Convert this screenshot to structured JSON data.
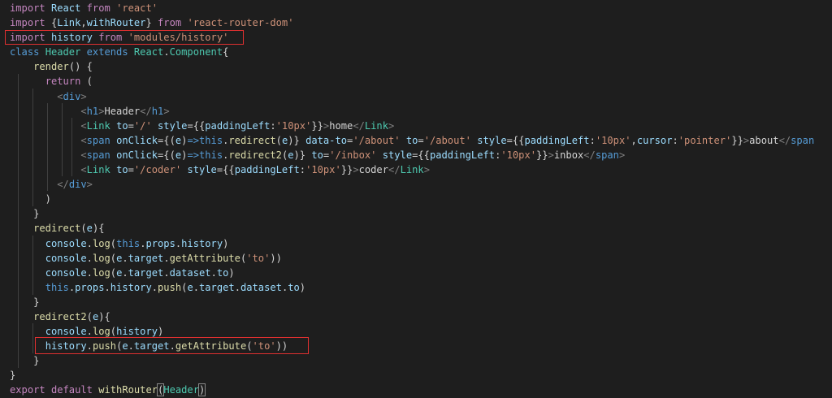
{
  "editor": {
    "theme_colors": {
      "background": "#1e1e1e",
      "keyword": "#569cd6",
      "control": "#c586c0",
      "string": "#ce9178",
      "function": "#dcdcaa",
      "type": "#4ec9b0",
      "variable": "#9cdcfe",
      "tag": "#569cd6",
      "tag_bracket": "#808080",
      "text": "#d4d4d4",
      "highlight_box": "#e03030"
    },
    "lines": [
      [
        [
          "kw-ctrl",
          "import"
        ],
        [
          "t",
          " "
        ],
        [
          "var",
          "React"
        ],
        [
          "t",
          " "
        ],
        [
          "kw-ctrl",
          "from"
        ],
        [
          "t",
          " "
        ],
        [
          "str",
          "'react'"
        ]
      ],
      [
        [
          "kw-ctrl",
          "import"
        ],
        [
          "t",
          " {"
        ],
        [
          "var",
          "Link"
        ],
        [
          "t",
          ","
        ],
        [
          "var",
          "withRouter"
        ],
        [
          "t",
          "} "
        ],
        [
          "kw-ctrl",
          "from"
        ],
        [
          "t",
          " "
        ],
        [
          "str",
          "'react-router-dom'"
        ]
      ],
      [
        [
          "kw-ctrl",
          "import"
        ],
        [
          "t",
          " "
        ],
        [
          "var",
          "history"
        ],
        [
          "t",
          " "
        ],
        [
          "kw-ctrl",
          "from"
        ],
        [
          "t",
          " "
        ],
        [
          "str",
          "'modules/history'"
        ]
      ],
      [
        [
          "kw",
          "class"
        ],
        [
          "t",
          " "
        ],
        [
          "type",
          "Header"
        ],
        [
          "t",
          " "
        ],
        [
          "kw",
          "extends"
        ],
        [
          "t",
          " "
        ],
        [
          "type",
          "React"
        ],
        [
          "t",
          "."
        ],
        [
          "type",
          "Component"
        ],
        [
          "t",
          "{"
        ]
      ],
      [
        [
          "t",
          "    "
        ],
        [
          "fn",
          "render"
        ],
        [
          "t",
          "() {"
        ]
      ],
      [
        [
          "t",
          "      "
        ],
        [
          "kw-ctrl",
          "return"
        ],
        [
          "t",
          " ("
        ]
      ],
      [
        [
          "t",
          "        "
        ],
        [
          "tb",
          "<"
        ],
        [
          "tag",
          "div"
        ],
        [
          "tb",
          ">"
        ]
      ],
      [
        [
          "t",
          "            "
        ],
        [
          "tb",
          "<"
        ],
        [
          "tag",
          "h1"
        ],
        [
          "tb",
          ">"
        ],
        [
          "t",
          "Header"
        ],
        [
          "tb",
          "</"
        ],
        [
          "tag",
          "h1"
        ],
        [
          "tb",
          ">"
        ]
      ],
      [
        [
          "t",
          "            "
        ],
        [
          "tb",
          "<"
        ],
        [
          "type",
          "Link"
        ],
        [
          "t",
          " "
        ],
        [
          "var",
          "to"
        ],
        [
          "t",
          "="
        ],
        [
          "str",
          "'/'"
        ],
        [
          "t",
          " "
        ],
        [
          "var",
          "style"
        ],
        [
          "t",
          "={{"
        ],
        [
          "var",
          "paddingLeft"
        ],
        [
          "t",
          ":"
        ],
        [
          "str",
          "'10px'"
        ],
        [
          "t",
          "}}"
        ],
        [
          "tb",
          ">"
        ],
        [
          "t",
          "home"
        ],
        [
          "tb",
          "</"
        ],
        [
          "type",
          "Link"
        ],
        [
          "tb",
          ">"
        ]
      ],
      [
        [
          "t",
          "            "
        ],
        [
          "tb",
          "<"
        ],
        [
          "tag",
          "span"
        ],
        [
          "t",
          " "
        ],
        [
          "var",
          "onClick"
        ],
        [
          "t",
          "={("
        ],
        [
          "var",
          "e"
        ],
        [
          "t",
          ")"
        ],
        [
          "kw",
          "=>"
        ],
        [
          "kw",
          "this"
        ],
        [
          "t",
          "."
        ],
        [
          "fn",
          "redirect"
        ],
        [
          "t",
          "("
        ],
        [
          "var",
          "e"
        ],
        [
          "t",
          ")} "
        ],
        [
          "var",
          "data-to"
        ],
        [
          "t",
          "="
        ],
        [
          "str",
          "'/about'"
        ],
        [
          "t",
          " "
        ],
        [
          "var",
          "to"
        ],
        [
          "t",
          "="
        ],
        [
          "str",
          "'/about'"
        ],
        [
          "t",
          " "
        ],
        [
          "var",
          "style"
        ],
        [
          "t",
          "={{"
        ],
        [
          "var",
          "paddingLeft"
        ],
        [
          "t",
          ":"
        ],
        [
          "str",
          "'10px'"
        ],
        [
          "t",
          ","
        ],
        [
          "var",
          "cursor"
        ],
        [
          "t",
          ":"
        ],
        [
          "str",
          "'pointer'"
        ],
        [
          "t",
          "}}"
        ],
        [
          "tb",
          ">"
        ],
        [
          "t",
          "about"
        ],
        [
          "tb",
          "</"
        ],
        [
          "tag",
          "span"
        ]
      ],
      [
        [
          "t",
          "            "
        ],
        [
          "tb",
          "<"
        ],
        [
          "tag",
          "span"
        ],
        [
          "t",
          " "
        ],
        [
          "var",
          "onClick"
        ],
        [
          "t",
          "={("
        ],
        [
          "var",
          "e"
        ],
        [
          "t",
          ")"
        ],
        [
          "kw",
          "=>"
        ],
        [
          "kw",
          "this"
        ],
        [
          "t",
          "."
        ],
        [
          "fn",
          "redirect2"
        ],
        [
          "t",
          "("
        ],
        [
          "var",
          "e"
        ],
        [
          "t",
          ")} "
        ],
        [
          "var",
          "to"
        ],
        [
          "t",
          "="
        ],
        [
          "str",
          "'/inbox'"
        ],
        [
          "t",
          " "
        ],
        [
          "var",
          "style"
        ],
        [
          "t",
          "={{"
        ],
        [
          "var",
          "paddingLeft"
        ],
        [
          "t",
          ":"
        ],
        [
          "str",
          "'10px'"
        ],
        [
          "t",
          "}}"
        ],
        [
          "tb",
          ">"
        ],
        [
          "t",
          "inbox"
        ],
        [
          "tb",
          "</"
        ],
        [
          "tag",
          "span"
        ],
        [
          "tb",
          ">"
        ]
      ],
      [
        [
          "t",
          "            "
        ],
        [
          "tb",
          "<"
        ],
        [
          "type",
          "Link"
        ],
        [
          "t",
          " "
        ],
        [
          "var",
          "to"
        ],
        [
          "t",
          "="
        ],
        [
          "str",
          "'/coder'"
        ],
        [
          "t",
          " "
        ],
        [
          "var",
          "style"
        ],
        [
          "t",
          "={{"
        ],
        [
          "var",
          "paddingLeft"
        ],
        [
          "t",
          ":"
        ],
        [
          "str",
          "'10px'"
        ],
        [
          "t",
          "}}"
        ],
        [
          "tb",
          ">"
        ],
        [
          "t",
          "coder"
        ],
        [
          "tb",
          "</"
        ],
        [
          "type",
          "Link"
        ],
        [
          "tb",
          ">"
        ]
      ],
      [
        [
          "t",
          "        "
        ],
        [
          "tb",
          "</"
        ],
        [
          "tag",
          "div"
        ],
        [
          "tb",
          ">"
        ]
      ],
      [
        [
          "t",
          "      )"
        ]
      ],
      [
        [
          "t",
          "    }"
        ]
      ],
      [
        [
          "t",
          "    "
        ],
        [
          "fn",
          "redirect"
        ],
        [
          "t",
          "("
        ],
        [
          "var",
          "e"
        ],
        [
          "t",
          "){"
        ]
      ],
      [
        [
          "t",
          "      "
        ],
        [
          "var",
          "console"
        ],
        [
          "t",
          "."
        ],
        [
          "fn",
          "log"
        ],
        [
          "t",
          "("
        ],
        [
          "kw",
          "this"
        ],
        [
          "t",
          "."
        ],
        [
          "var",
          "props"
        ],
        [
          "t",
          "."
        ],
        [
          "var",
          "history"
        ],
        [
          "t",
          ")"
        ]
      ],
      [
        [
          "t",
          "      "
        ],
        [
          "var",
          "console"
        ],
        [
          "t",
          "."
        ],
        [
          "fn",
          "log"
        ],
        [
          "t",
          "("
        ],
        [
          "var",
          "e"
        ],
        [
          "t",
          "."
        ],
        [
          "var",
          "target"
        ],
        [
          "t",
          "."
        ],
        [
          "fn",
          "getAttribute"
        ],
        [
          "t",
          "("
        ],
        [
          "str",
          "'to'"
        ],
        [
          "t",
          "))"
        ]
      ],
      [
        [
          "t",
          "      "
        ],
        [
          "var",
          "console"
        ],
        [
          "t",
          "."
        ],
        [
          "fn",
          "log"
        ],
        [
          "t",
          "("
        ],
        [
          "var",
          "e"
        ],
        [
          "t",
          "."
        ],
        [
          "var",
          "target"
        ],
        [
          "t",
          "."
        ],
        [
          "var",
          "dataset"
        ],
        [
          "t",
          "."
        ],
        [
          "var",
          "to"
        ],
        [
          "t",
          ")"
        ]
      ],
      [
        [
          "t",
          "      "
        ],
        [
          "kw",
          "this"
        ],
        [
          "t",
          "."
        ],
        [
          "var",
          "props"
        ],
        [
          "t",
          "."
        ],
        [
          "var",
          "history"
        ],
        [
          "t",
          "."
        ],
        [
          "fn",
          "push"
        ],
        [
          "t",
          "("
        ],
        [
          "var",
          "e"
        ],
        [
          "t",
          "."
        ],
        [
          "var",
          "target"
        ],
        [
          "t",
          "."
        ],
        [
          "var",
          "dataset"
        ],
        [
          "t",
          "."
        ],
        [
          "var",
          "to"
        ],
        [
          "t",
          ")"
        ]
      ],
      [
        [
          "t",
          "    }"
        ]
      ],
      [
        [
          "t",
          "    "
        ],
        [
          "fn",
          "redirect2"
        ],
        [
          "t",
          "("
        ],
        [
          "var",
          "e"
        ],
        [
          "t",
          "){"
        ]
      ],
      [
        [
          "t",
          "      "
        ],
        [
          "var",
          "console"
        ],
        [
          "t",
          "."
        ],
        [
          "fn",
          "log"
        ],
        [
          "t",
          "("
        ],
        [
          "var",
          "history"
        ],
        [
          "t",
          ")"
        ]
      ],
      [
        [
          "t",
          "      "
        ],
        [
          "var",
          "history"
        ],
        [
          "t",
          "."
        ],
        [
          "fn",
          "push"
        ],
        [
          "t",
          "("
        ],
        [
          "var",
          "e"
        ],
        [
          "t",
          "."
        ],
        [
          "var",
          "target"
        ],
        [
          "t",
          "."
        ],
        [
          "fn",
          "getAttribute"
        ],
        [
          "t",
          "("
        ],
        [
          "str",
          "'to'"
        ],
        [
          "t",
          "))"
        ]
      ],
      [
        [
          "t",
          "    }"
        ]
      ],
      [
        [
          "t",
          "}"
        ]
      ],
      [
        [
          "kw-ctrl",
          "export"
        ],
        [
          "t",
          " "
        ],
        [
          "kw-ctrl",
          "default"
        ],
        [
          "t",
          " "
        ],
        [
          "fn",
          "withRouter"
        ],
        [
          "br",
          "("
        ],
        [
          "type",
          "Header"
        ],
        [
          "br",
          ")"
        ]
      ]
    ]
  }
}
